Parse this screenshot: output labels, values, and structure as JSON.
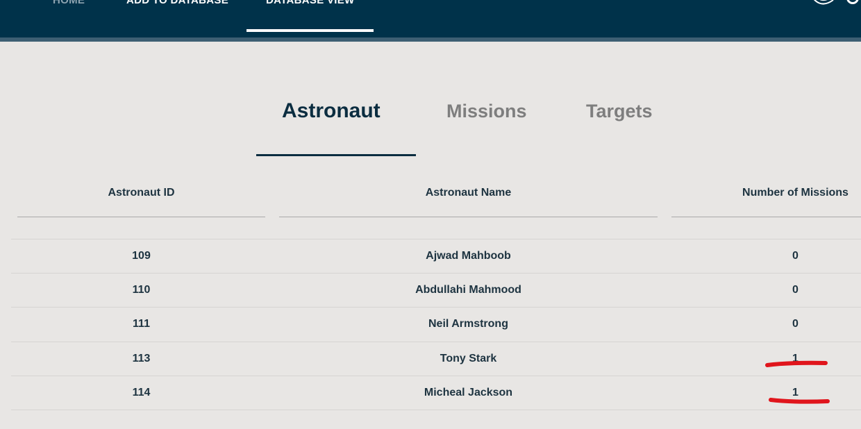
{
  "nav": {
    "items": [
      "HOME",
      "ADD TO DATABASE",
      "DATABASE VIEW"
    ],
    "active": "DATABASE VIEW"
  },
  "tabs": [
    "Astronaut",
    "Missions",
    "Targets"
  ],
  "active_tab": "Astronaut",
  "table": {
    "headers": [
      "Astronaut ID",
      "Astronaut Name",
      "Number of Missions"
    ],
    "rows": [
      [
        "109",
        "Ajwad Mahboob",
        "0"
      ],
      [
        "110",
        "Abdullahi Mahmood",
        "0"
      ],
      [
        "111",
        "Neil Armstrong",
        "0"
      ],
      [
        "113",
        "Tony Stark",
        "1"
      ],
      [
        "114",
        "Micheal Jackson",
        "1"
      ]
    ]
  },
  "colors": {
    "nav_bg": "#00324a",
    "page_bg": "#e8e6e4",
    "text": "#1d3340",
    "annotation": "#e0151c"
  }
}
